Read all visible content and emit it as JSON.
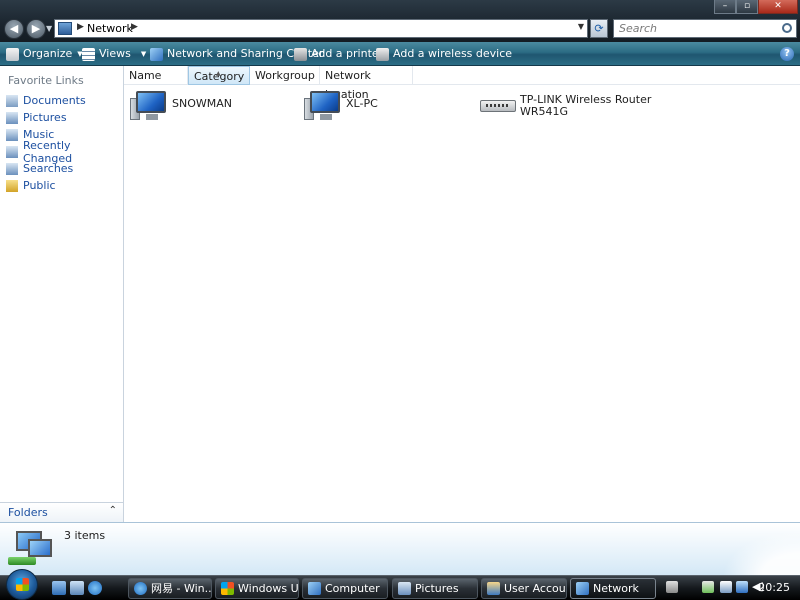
{
  "window": {
    "address": "Network",
    "search_placeholder": "Search"
  },
  "commandbar": {
    "organize": "Organize",
    "views": "Views",
    "network_sharing": "Network and Sharing Center",
    "add_printer": "Add a printer",
    "add_wireless": "Add a wireless device"
  },
  "navpane": {
    "favorites_title": "Favorite Links",
    "items": [
      {
        "label": "Documents",
        "icon": "documents-icon"
      },
      {
        "label": "Pictures",
        "icon": "pictures-icon"
      },
      {
        "label": "Music",
        "icon": "music-icon"
      },
      {
        "label": "Recently Changed",
        "icon": "recently-changed-icon"
      },
      {
        "label": "Searches",
        "icon": "searches-icon"
      },
      {
        "label": "Public",
        "icon": "public-folder-icon"
      }
    ],
    "folders_label": "Folders"
  },
  "columns": [
    "Name",
    "Category",
    "Workgroup",
    "Network location"
  ],
  "items": [
    {
      "name": "SNOWMAN",
      "icon": "computer-icon"
    },
    {
      "name": "XL-PC",
      "icon": "computer-icon"
    },
    {
      "name_line1": "TP-LINK Wireless Router",
      "name_line2": "WR541G",
      "icon": "router-icon"
    }
  ],
  "details": {
    "count_text": "3 items"
  },
  "taskbar": {
    "tasks": [
      {
        "label": "网易 - Win..."
      },
      {
        "label": "Windows U..."
      },
      {
        "label": "Computer"
      },
      {
        "label": "Pictures"
      },
      {
        "label": "User Accou..."
      },
      {
        "label": "Network"
      }
    ],
    "clock": "20:25"
  },
  "colors": {
    "link_blue": "#1c4fa0",
    "cmdbar_teal": "#2b6b83",
    "titlebar_dark": "#1a242d"
  }
}
